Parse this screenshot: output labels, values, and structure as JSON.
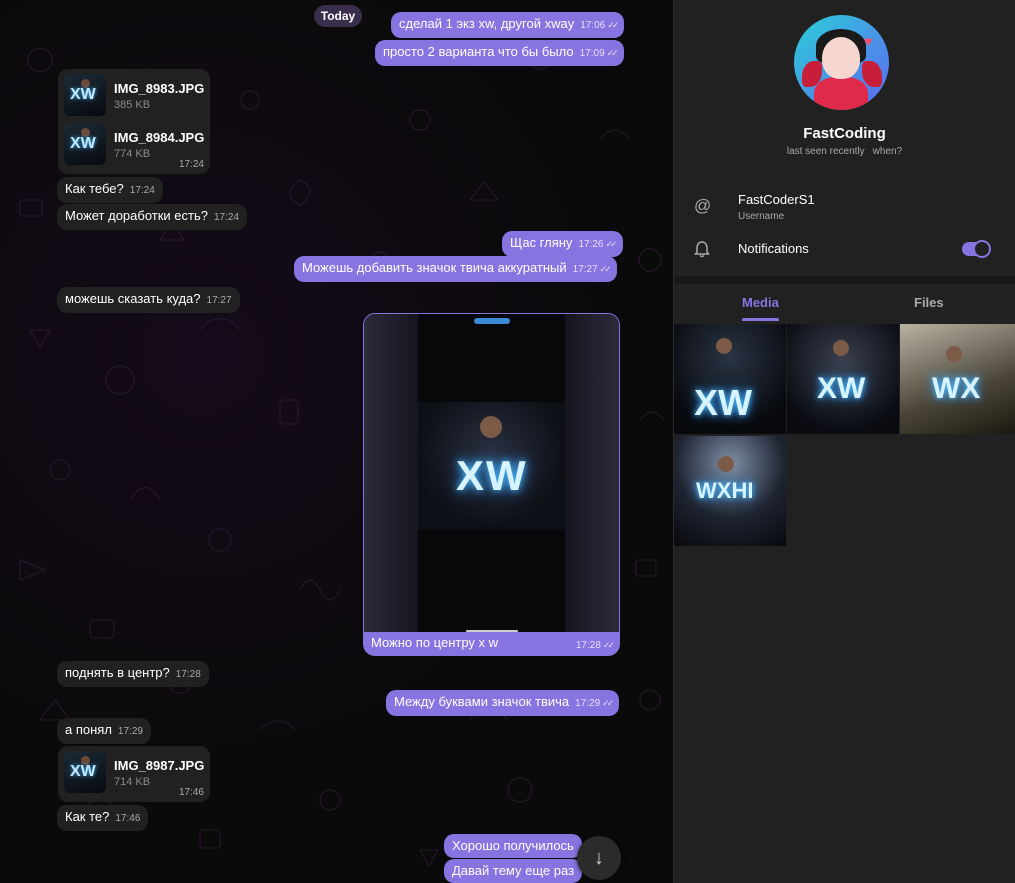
{
  "chat": {
    "date_label": "Today",
    "messages": [
      {
        "text": "сделай 1 экз xw, другой xway",
        "time": "17:06"
      },
      {
        "text": "просто 2 варианта что бы было",
        "time": "17:09"
      },
      {
        "file_name": "IMG_8983.JPG",
        "file_size": "385 KB"
      },
      {
        "file_name": "IMG_8984.JPG",
        "file_size": "774 KB",
        "time": "17:24"
      },
      {
        "text": "Как тебе?",
        "time": "17:24"
      },
      {
        "text": "Может доработки есть?",
        "time": "17:24"
      },
      {
        "text": "Щас гляну",
        "time": "17:26"
      },
      {
        "text": "Можешь добавить значок твича аккуратный",
        "time": "17:27"
      },
      {
        "text": "можешь сказать куда?",
        "time": "17:27"
      },
      {
        "caption": "Можно по центру x w",
        "time": "17:28",
        "photo_text": "XW"
      },
      {
        "text": "поднять в центр?",
        "time": "17:28"
      },
      {
        "text": "Между буквами значок твича",
        "time": "17:29"
      },
      {
        "text": "а понял",
        "time": "17:29"
      },
      {
        "file_name": "IMG_8987.JPG",
        "file_size": "714 KB",
        "time": "17:46"
      },
      {
        "text": "Как те?",
        "time": "17:46"
      },
      {
        "text": "Хорошо получилось"
      },
      {
        "text": "Давай тему еще раз"
      }
    ],
    "thumb_text": "XW",
    "check_glyph": "✓✓",
    "scroll_icon": "arrow-down-icon"
  },
  "profile": {
    "name": "FastCoding",
    "status": "last seen recently",
    "when_link": "when?",
    "username": "FastCoderS1",
    "username_label": "Username",
    "notifications_label": "Notifications",
    "notifications_on": true,
    "tabs": [
      "Media",
      "Files"
    ],
    "active_tab": "Media",
    "media_texts": [
      "XW",
      "XW",
      "WX",
      "WXHI"
    ]
  },
  "colors": {
    "accent": "#8774e1",
    "incoming_bubble": "#212121",
    "panel_bg": "#212121",
    "chat_bg": "#0a0a0a"
  }
}
